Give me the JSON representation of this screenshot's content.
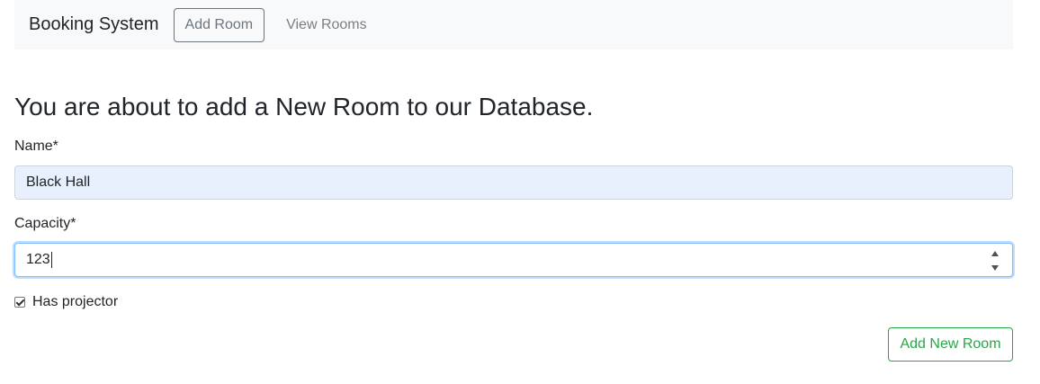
{
  "navbar": {
    "brand": "Booking System",
    "add_room_label": "Add Room",
    "view_rooms_label": "View Rooms"
  },
  "main": {
    "heading": "You are about to add a New Room to our Database.",
    "form": {
      "name_label": "Name*",
      "name_value": "Black Hall",
      "capacity_label": "Capacity*",
      "capacity_value": "123",
      "projector_label": "Has projector",
      "projector_checked": true,
      "submit_label": "Add New Room"
    }
  },
  "colors": {
    "navbar_bg": "#f8f9fa",
    "submit_accent": "#28a745",
    "autofill_bg": "#e8f0fe",
    "focus_border": "#80bdff"
  }
}
